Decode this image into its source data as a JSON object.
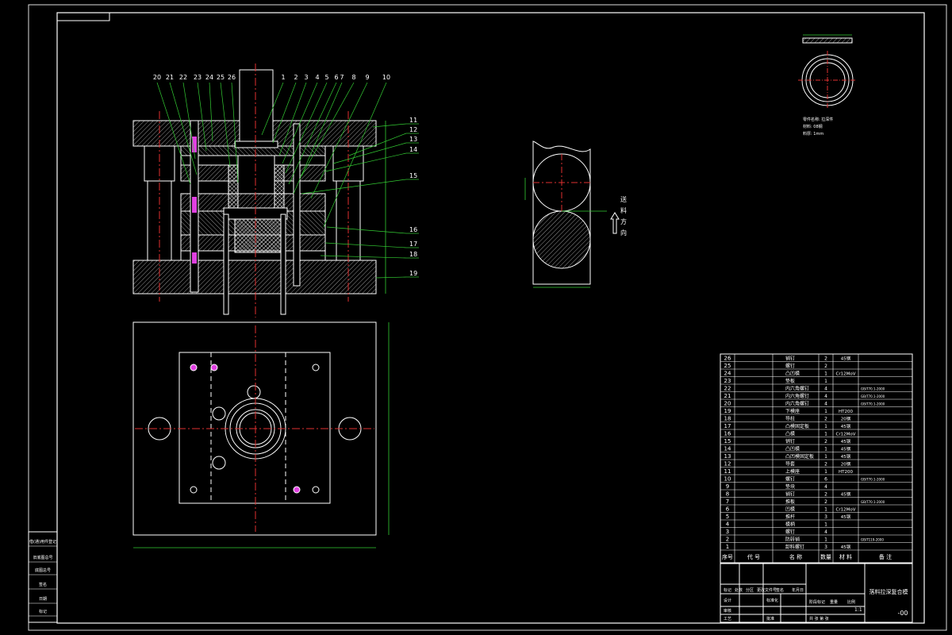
{
  "balloons_top": [
    "20",
    "21",
    "22",
    "23",
    "24",
    "25",
    "26",
    "1",
    "2",
    "3",
    "4",
    "5",
    "6",
    "7",
    "8",
    "9",
    "10"
  ],
  "balloons_right": [
    "11",
    "12",
    "13",
    "14",
    "15",
    "16",
    "17",
    "18",
    "19"
  ],
  "feed_direction": [
    "送",
    "料",
    "方",
    "向"
  ],
  "part_notes": [
    "零件名称: 拉深件",
    "材料: 08钢",
    "料厚: 1mm"
  ],
  "bom_rows": [
    {
      "no": "26",
      "name": "销钉",
      "qty": "2",
      "mat": "45钢",
      "note": ""
    },
    {
      "no": "25",
      "name": "螺钉",
      "qty": "2",
      "mat": "",
      "note": ""
    },
    {
      "no": "24",
      "name": "凸凹模",
      "qty": "1",
      "mat": "Cr12MoV",
      "note": ""
    },
    {
      "no": "23",
      "name": "垫板",
      "qty": "1",
      "mat": "",
      "note": ""
    },
    {
      "no": "22",
      "name": "内六角螺钉",
      "qty": "4",
      "mat": "",
      "note": "GB/T70.1-2000"
    },
    {
      "no": "21",
      "name": "内六角螺钉",
      "qty": "4",
      "mat": "",
      "note": "GB/T70.1-2000"
    },
    {
      "no": "20",
      "name": "内六角螺钉",
      "qty": "4",
      "mat": "",
      "note": "GB/T70.1-2000"
    },
    {
      "no": "19",
      "name": "下模座",
      "qty": "1",
      "mat": "HT200",
      "note": ""
    },
    {
      "no": "18",
      "name": "导柱",
      "qty": "2",
      "mat": "20钢",
      "note": ""
    },
    {
      "no": "17",
      "name": "凸模固定板",
      "qty": "1",
      "mat": "45钢",
      "note": ""
    },
    {
      "no": "16",
      "name": "凸模",
      "qty": "1",
      "mat": "Cr12MoV",
      "note": ""
    },
    {
      "no": "15",
      "name": "销钉",
      "qty": "2",
      "mat": "45钢",
      "note": ""
    },
    {
      "no": "14",
      "name": "凸凹模",
      "qty": "1",
      "mat": "45钢",
      "note": ""
    },
    {
      "no": "13",
      "name": "凸凹模固定板",
      "qty": "1",
      "mat": "45钢",
      "note": ""
    },
    {
      "no": "12",
      "name": "导套",
      "qty": "2",
      "mat": "20钢",
      "note": ""
    },
    {
      "no": "11",
      "name": "上模座",
      "qty": "1",
      "mat": "HT200",
      "note": ""
    },
    {
      "no": "10",
      "name": "螺钉",
      "qty": "6",
      "mat": "",
      "note": "GB/T70.1-2000"
    },
    {
      "no": "9",
      "name": "垫块",
      "qty": "4",
      "mat": "",
      "note": ""
    },
    {
      "no": "8",
      "name": "销钉",
      "qty": "2",
      "mat": "45钢",
      "note": ""
    },
    {
      "no": "7",
      "name": "推板",
      "qty": "2",
      "mat": "",
      "note": "GB/T70.1-2000"
    },
    {
      "no": "6",
      "name": "凹模",
      "qty": "1",
      "mat": "Cr12MoV",
      "note": ""
    },
    {
      "no": "5",
      "name": "推杆",
      "qty": "3",
      "mat": "45钢",
      "note": ""
    },
    {
      "no": "4",
      "name": "模柄",
      "qty": "1",
      "mat": "",
      "note": ""
    },
    {
      "no": "3",
      "name": "螺钉",
      "qty": "4",
      "mat": "",
      "note": ""
    },
    {
      "no": "2",
      "name": "防转销",
      "qty": "1",
      "mat": "",
      "note": "GB/T119-2000"
    },
    {
      "no": "1",
      "name": "卸料螺钉",
      "qty": "3",
      "mat": "45钢",
      "note": ""
    }
  ],
  "bom_header": {
    "no": "序号",
    "code": "代 号",
    "name": "名 称",
    "qty": "数量",
    "mat": "材 料",
    "note": "备 注"
  },
  "title_block": {
    "drawing_name": "落料拉深复合模",
    "scale": "1:1",
    "drawing_no": "-00",
    "labels": [
      "标记",
      "处数",
      "分区",
      "更改文件号",
      "签名",
      "年月日",
      "设计",
      "标准化",
      "审核",
      "工艺",
      "批准",
      "阶段标记",
      "重量",
      "比例",
      "共 张 第 张"
    ]
  },
  "side_box": [
    "借(通)用件登记",
    "旧底图总号",
    "底图总号",
    "签名",
    "日期",
    "标记"
  ]
}
